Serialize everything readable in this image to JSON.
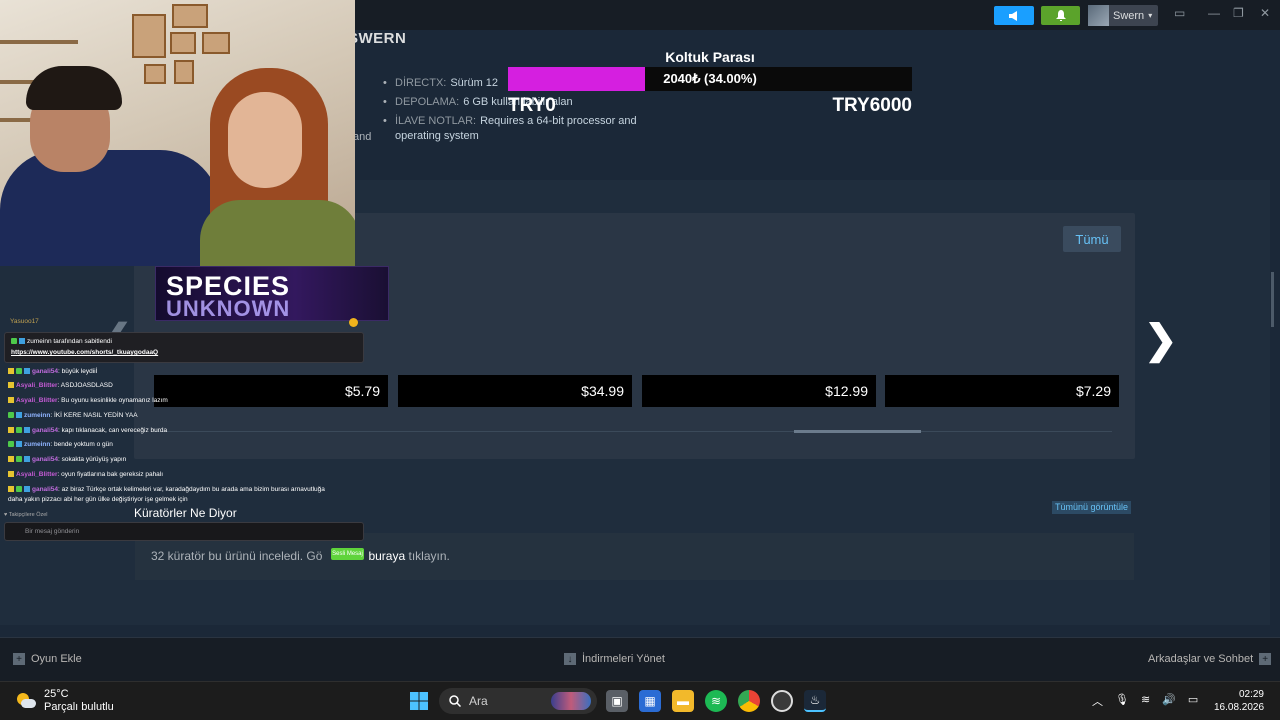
{
  "topbar": {
    "username": "Swern",
    "colors": {
      "announce": "#1a9fff",
      "notifications": "#5ba32b"
    }
  },
  "page": {
    "header_partial": "SWERN",
    "sysreq": [
      {
        "key": "DİRECTX:",
        "value": "Sürüm 12"
      },
      {
        "key": "DEPOLAMA:",
        "value": "6 GB kullanılabilir alan"
      },
      {
        "key": "İLAVE NOTLAR:",
        "value": "Requires a 64-bit processor and operating system"
      }
    ],
    "stray_text": "and"
  },
  "overlay_goal": {
    "title": "Koltuk Parası",
    "progress_text": "2040₺ (34.00%)",
    "progress_fraction": 0.34,
    "min_label": "TRY0",
    "max_label": "TRY6000",
    "fill_color": "#d51fe0"
  },
  "carousel": {
    "all_button": "Tümü",
    "prices": [
      "$5.79",
      "$34.99",
      "$12.99",
      "$7.29"
    ]
  },
  "curators": {
    "title": "Küratörler Ne Diyor",
    "view_all": "Tümünü görüntüle",
    "text_before": "32 küratör bu ürünü inceledi. Gö",
    "link_text": "buraya",
    "text_after": " tıklayın.",
    "badge_text": "Sesli Mesaj"
  },
  "bottombar": {
    "add_game": "Oyun Ekle",
    "downloads": "İndirmeleri Yönet",
    "friends": "Arkadaşlar ve Sohbet"
  },
  "taskbar": {
    "temperature": "25°C",
    "weather": "Parçalı bulutlu",
    "search": "Ara",
    "time": "02:29",
    "date": "16.08.2026"
  },
  "stream": {
    "banner_line1": "SPECIES",
    "banner_line2": "UNKNOWN",
    "chat_top_user": "Yasuoo17",
    "pinned_by": "zumeinn tarafından sabitlendi",
    "pinned_link": "https://www.youtube.com/shorts/_tkuaygodaaQ",
    "messages": [
      {
        "user": "ganali54",
        "text": ": büyük leydiiİ"
      },
      {
        "user": "Asyali_Blitter",
        "text": ": ASDJOASDLASD"
      },
      {
        "user": "Asyali_Blitter",
        "text": ": Bu oyunu kesinlikle oynamanız lazım"
      },
      {
        "user": "zumeinn",
        "text": ": İKİ KERE NASIL YEDİN YAA"
      },
      {
        "user": "ganali54",
        "text": ": kapı tıklanacak, can vereceğiz burda"
      },
      {
        "user": "zumeinn",
        "text": ": bende yoktum o gün"
      },
      {
        "user": "ganali54",
        "text": ": sokakta yürüyüş yapın"
      },
      {
        "user": "Asyali_Blitter",
        "text": ": oyun fiyatlarına bak gereksiz pahalı"
      },
      {
        "user": "ganali54",
        "text": ": az biraz Türkçe ortak kelimeleri var, karadağdaydım bu arada ama bizim burası arnavutluğa"
      },
      {
        "user": "",
        "text": "daha yakın pizzacı abi her gün ülke değiştiriyor işe gelmek için"
      }
    ],
    "followers_only": "Takipçilere Özel",
    "chat_placeholder": "Bir mesaj gönderin"
  }
}
